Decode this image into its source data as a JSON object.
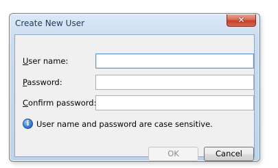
{
  "dialog": {
    "title": "Create New User",
    "close_symbol": "✕"
  },
  "fields": [
    {
      "label_mnemonic": "U",
      "label_rest": "ser name:",
      "value": ""
    },
    {
      "label_mnemonic": "P",
      "label_rest": "assword:",
      "value": ""
    },
    {
      "label_mnemonic": "C",
      "label_rest": "onfirm password:",
      "value": ""
    }
  ],
  "info": {
    "icon": "info-icon",
    "icon_glyph": "i",
    "text": "User name and password are case sensitive."
  },
  "buttons": {
    "ok_label": "OK",
    "ok_enabled": false,
    "cancel_label": "Cancel"
  },
  "colors": {
    "title_text": "#1e395b",
    "close_button": "#c2412a",
    "focus_border": "#5b9bd5",
    "info_icon": "#3b7fd0"
  }
}
